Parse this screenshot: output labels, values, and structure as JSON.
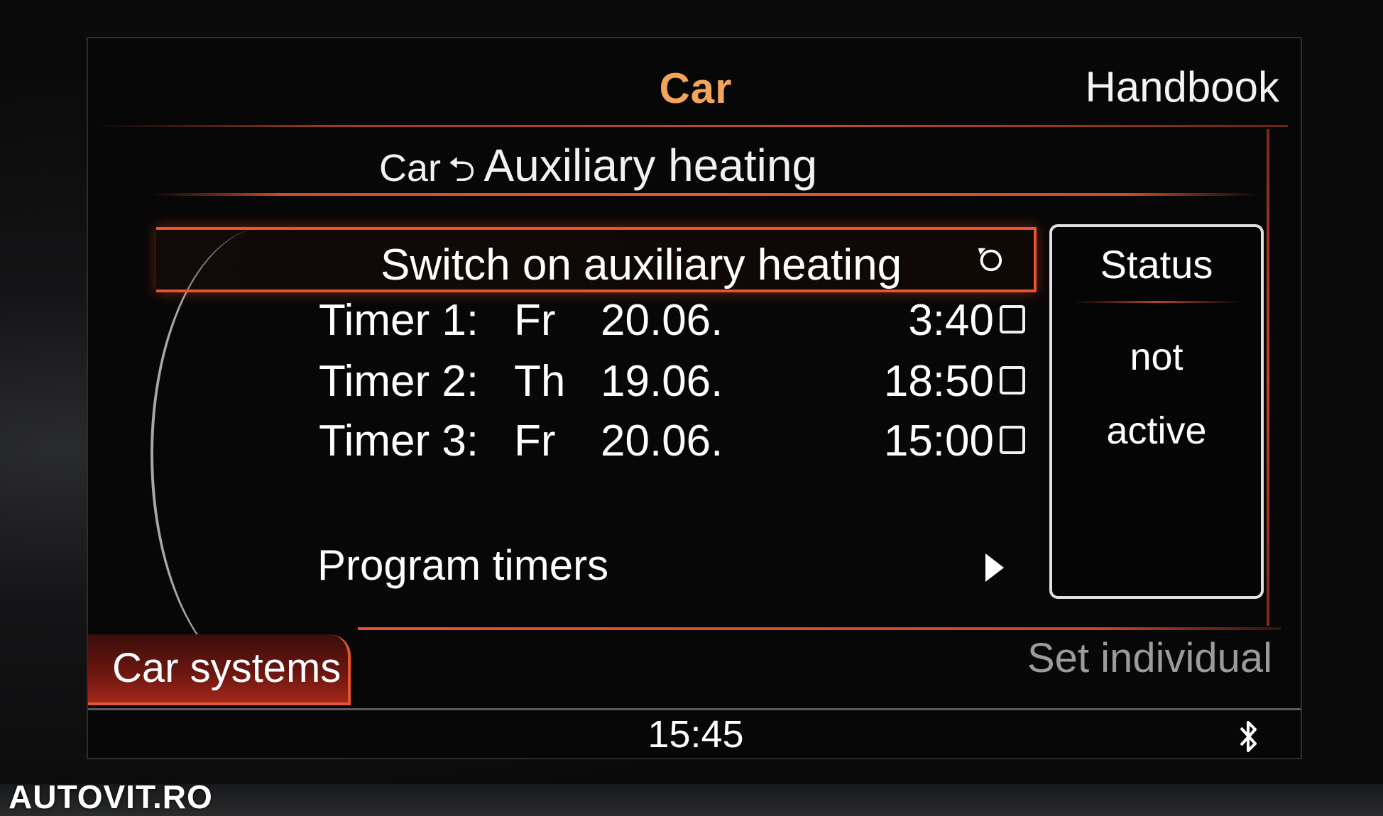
{
  "header": {
    "title": "Car",
    "handbook_label": "Handbook"
  },
  "breadcrumb": {
    "parent": "Car",
    "arrow": "⮌",
    "current": "Auxiliary heating"
  },
  "menu": {
    "switch_on_label": "Switch on auxiliary heating",
    "timers": [
      {
        "name": "Timer 1:",
        "day": "Fr",
        "date": "20.06.",
        "time": "3:40",
        "checked": false
      },
      {
        "name": "Timer 2:",
        "day": "Th",
        "date": "19.06.",
        "time": "18:50",
        "checked": false
      },
      {
        "name": "Timer 3:",
        "day": "Fr",
        "date": "20.06.",
        "time": "15:00",
        "checked": false
      }
    ],
    "program_timers_label": "Program timers"
  },
  "status_panel": {
    "title": "Status",
    "line1": "not",
    "line2": "active"
  },
  "bottom_bar": {
    "left_tab_label": "Car systems",
    "right_label": "Set individual",
    "clock": "15:45",
    "bluetooth_icon": "bluetooth-icon"
  },
  "watermark": "AUTOVIT.RO",
  "colors": {
    "accent": "#e9532d",
    "title_orange": "#f3a65a",
    "text": "#ffffff",
    "muted": "#9b9b9b"
  }
}
